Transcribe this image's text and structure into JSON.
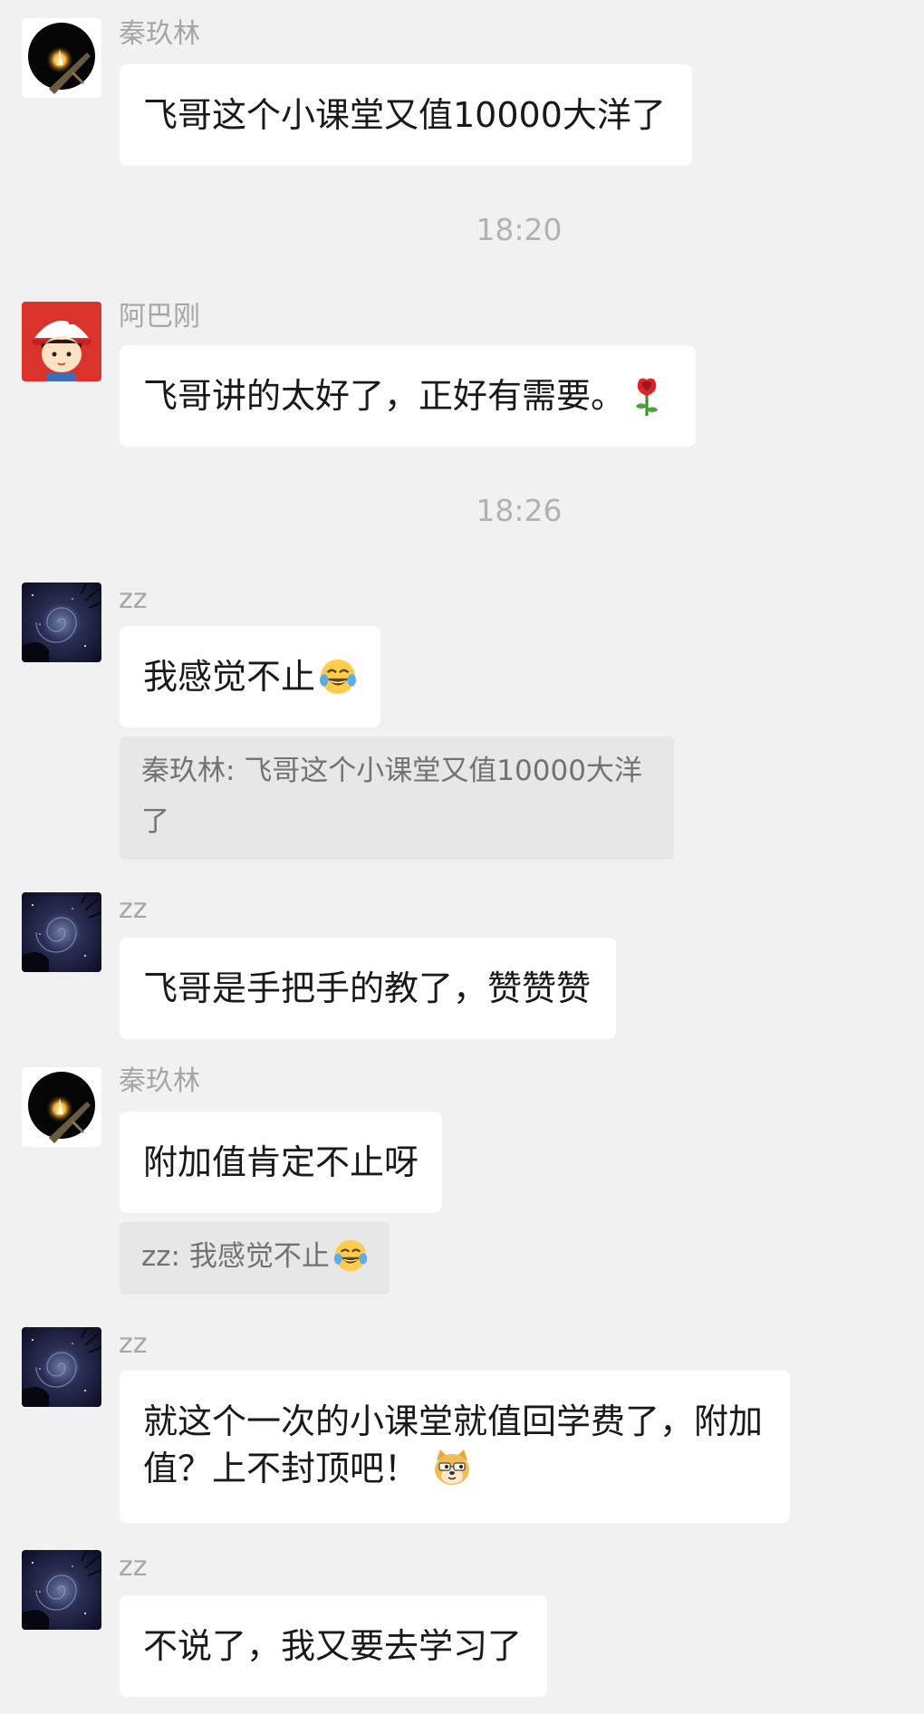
{
  "colors": {
    "background": "#f1f1f1",
    "bubble": "#ffffff",
    "quote_bubble": "#e7e7e7",
    "name_text": "#a6a6a6",
    "timestamp_text": "#b2b2b2"
  },
  "timestamps": [
    "18:20",
    "18:26"
  ],
  "messages": [
    {
      "sender": "秦玖林",
      "avatar_icon": "campfire-avatar",
      "text": "飞哥这个小课堂又值10000大洋了"
    },
    {
      "sender": "阿巴刚",
      "avatar_icon": "cartoon-boy-cap-avatar",
      "text": "飞哥讲的太好了，正好有需要。",
      "emoji": "rose-icon"
    },
    {
      "sender": "zz",
      "avatar_icon": "night-sky-avatar",
      "text": "我感觉不止",
      "emoji": "tears-of-joy-icon",
      "quote": "秦玖林: 飞哥这个小课堂又值10000大洋了"
    },
    {
      "sender": "zz",
      "avatar_icon": "night-sky-avatar",
      "text": "飞哥是手把手的教了，赞赞赞"
    },
    {
      "sender": "秦玖林",
      "avatar_icon": "campfire-avatar",
      "text": "附加值肯定不止呀",
      "quote": "zz: 我感觉不止",
      "quote_emoji": "tears-of-joy-icon"
    },
    {
      "sender": "zz",
      "avatar_icon": "night-sky-avatar",
      "text_line1": "就这个一次的小课堂就值回学费了，附加",
      "text_line2": "值？上不封顶吧！",
      "emoji": "doge-icon"
    },
    {
      "sender": "zz",
      "avatar_icon": "night-sky-avatar",
      "text": "不说了，我又要去学习了"
    }
  ]
}
